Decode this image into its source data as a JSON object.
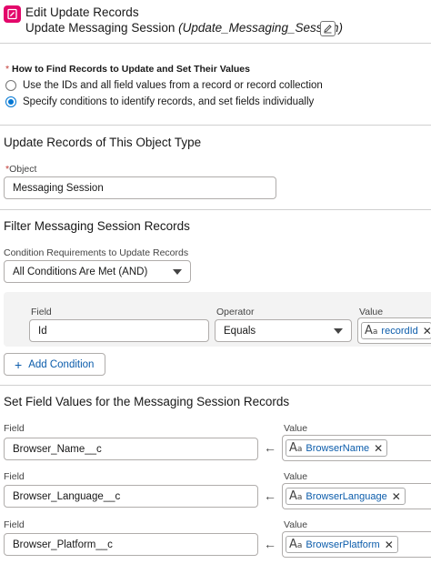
{
  "header": {
    "title": "Edit Update Records",
    "label": "Update Messaging Session",
    "api_name": "(Update_Messaging_Session)",
    "icon": "update-records-icon",
    "icon_color": "#e3066a"
  },
  "how_to_find": {
    "required_mark": "*",
    "question": "How to Find Records to Update and Set Their Values",
    "options": [
      {
        "label": "Use the IDs and all field values from a record or record collection",
        "selected": false
      },
      {
        "label": "Specify conditions to identify records, and set fields individually",
        "selected": true
      }
    ]
  },
  "object_section": {
    "title": "Update Records of This Object Type",
    "object_label": "Object",
    "required_mark": "*",
    "object_value": "Messaging Session"
  },
  "filter_section": {
    "title": "Filter Messaging Session Records",
    "condition_label": "Condition Requirements to Update Records",
    "condition_value": "All Conditions Are Met (AND)",
    "columns": {
      "field": "Field",
      "operator": "Operator",
      "value": "Value"
    },
    "condition": {
      "field": "Id",
      "operator": "Equals",
      "value": "recordId"
    },
    "add_condition": "Add Condition"
  },
  "set_section": {
    "title": "Set Field Values for the Messaging Session Records",
    "rows": [
      {
        "field_label": "Field",
        "field": "Browser_Name__c",
        "value_label": "Value",
        "value": "BrowserName"
      },
      {
        "field_label": "Field",
        "field": "Browser_Language__c",
        "value_label": "Value",
        "value": "BrowserLanguage"
      },
      {
        "field_label": "Field",
        "field": "Browser_Platform__c",
        "value_label": "Value",
        "value": "BrowserPlatform"
      }
    ]
  },
  "colors": {
    "accent": "#0176d3",
    "link": "#0b5cab",
    "required": "#c23934"
  }
}
